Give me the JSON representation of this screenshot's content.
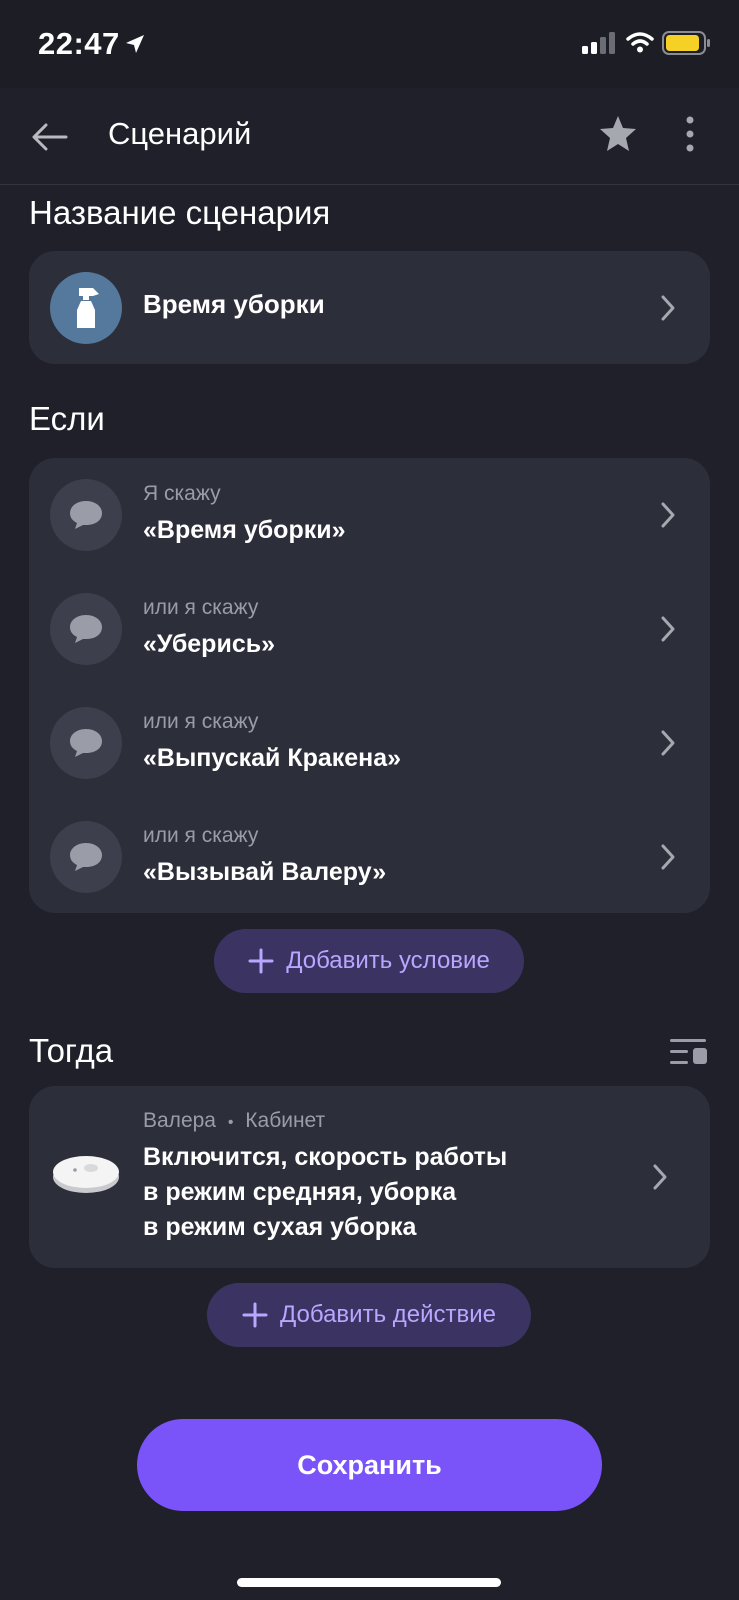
{
  "status_bar": {
    "time": "22:47"
  },
  "app_bar": {
    "title": "Сценарий"
  },
  "name_section": {
    "title": "Название сценария",
    "scenario_name": "Время уборки"
  },
  "if_section": {
    "title": "Если",
    "conditions": [
      {
        "sub": "Я скажу",
        "phrase": "«Время уборки»"
      },
      {
        "sub": "или я скажу",
        "phrase": "«Уберись»"
      },
      {
        "sub": "или я скажу",
        "phrase": "«Выпускай Кракена»"
      },
      {
        "sub": "или я скажу",
        "phrase": "«Вызывай Валеру»"
      }
    ],
    "add_label": "Добавить условие"
  },
  "then_section": {
    "title": "Тогда",
    "action": {
      "device": "Валера",
      "separator": "•",
      "room": "Кабинет",
      "lines": [
        "Включится, скорость работы",
        "в режим средняя, уборка",
        "в режим сухая уборка"
      ]
    },
    "add_label": "Добавить действие"
  },
  "save_label": "Сохранить",
  "colors": {
    "accent": "#7a54f9",
    "background": "#1f2029",
    "card": "#2c2e3a",
    "battery": "#f6d125"
  },
  "icons": [
    "location-arrow-icon",
    "signal-icon",
    "wifi-icon",
    "battery-icon",
    "back-arrow-icon",
    "star-icon",
    "more-vertical-icon",
    "spray-bottle-icon",
    "speech-bubble-icon",
    "chevron-right-icon",
    "plus-icon",
    "sort-icon",
    "robot-vacuum-icon"
  ]
}
